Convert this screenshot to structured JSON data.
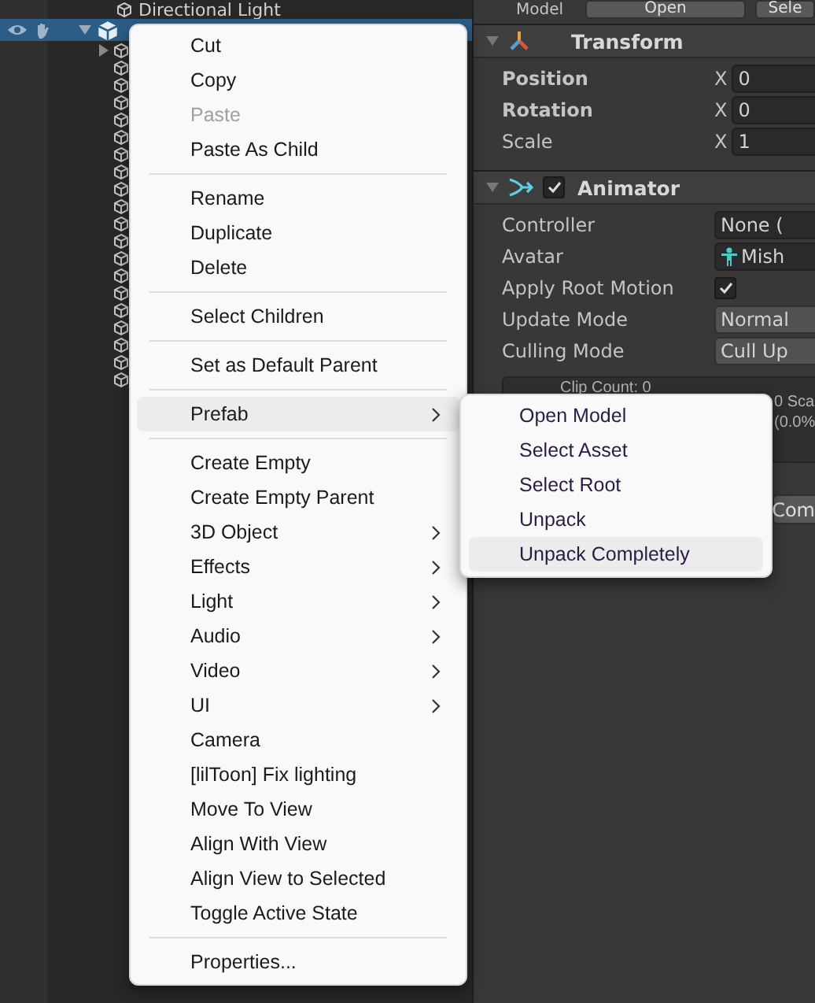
{
  "hierarchy": {
    "rows": [
      {
        "label": "Directional Light",
        "kind": "light",
        "selected": false
      },
      {
        "kind": "prefab",
        "selected": true
      }
    ],
    "children": [
      {
        "expandable": true
      },
      {
        "expandable": false
      },
      {
        "expandable": false
      },
      {
        "expandable": false
      },
      {
        "expandable": false
      },
      {
        "expandable": false
      },
      {
        "expandable": false
      },
      {
        "expandable": false
      },
      {
        "expandable": false
      },
      {
        "expandable": false
      },
      {
        "expandable": false
      },
      {
        "expandable": false
      },
      {
        "expandable": false
      },
      {
        "expandable": false
      },
      {
        "expandable": false
      },
      {
        "expandable": false
      },
      {
        "expandable": false
      },
      {
        "expandable": false
      },
      {
        "expandable": false
      },
      {
        "expandable": false
      }
    ]
  },
  "inspector": {
    "model_row": {
      "label": "Model",
      "buttons": [
        "Open",
        "Sele"
      ]
    },
    "transform": {
      "title": "Transform",
      "rows": [
        {
          "label": "Position",
          "modified": true,
          "axis": "X",
          "value": "0"
        },
        {
          "label": "Rotation",
          "modified": true,
          "axis": "X",
          "value": "0"
        },
        {
          "label": "Scale",
          "modified": false,
          "axis": "X",
          "value": "1"
        }
      ]
    },
    "animator": {
      "title": "Animator",
      "enabled": true,
      "rows": [
        {
          "label": "Controller",
          "kind": "object",
          "value": "None ("
        },
        {
          "label": "Avatar",
          "kind": "avatar",
          "value": "Mish"
        },
        {
          "label": "Apply Root Motion",
          "kind": "checkbox",
          "checked": true
        },
        {
          "label": "Update Mode",
          "kind": "dropdown",
          "value": "Normal"
        },
        {
          "label": "Culling Mode",
          "kind": "dropdown",
          "value": "Cull Up"
        }
      ],
      "info": {
        "clip_count": "Clip Count: 0",
        "right_lines": [
          "0 Sca",
          "(0.0%"
        ]
      },
      "button": "Com"
    }
  },
  "context_menu": {
    "groups": [
      [
        {
          "label": "Cut",
          "disabled": false,
          "has_submenu": false,
          "selected": false
        },
        {
          "label": "Copy",
          "disabled": false,
          "has_submenu": false,
          "selected": false
        },
        {
          "label": "Paste",
          "disabled": true,
          "has_submenu": false,
          "selected": false
        },
        {
          "label": "Paste As Child",
          "disabled": false,
          "has_submenu": false,
          "selected": false
        }
      ],
      [
        {
          "label": "Rename",
          "disabled": false,
          "has_submenu": false,
          "selected": false
        },
        {
          "label": "Duplicate",
          "disabled": false,
          "has_submenu": false,
          "selected": false
        },
        {
          "label": "Delete",
          "disabled": false,
          "has_submenu": false,
          "selected": false
        }
      ],
      [
        {
          "label": "Select Children",
          "disabled": false,
          "has_submenu": false,
          "selected": false
        }
      ],
      [
        {
          "label": "Set as Default Parent",
          "disabled": false,
          "has_submenu": false,
          "selected": false
        }
      ],
      [
        {
          "label": "Prefab",
          "disabled": false,
          "has_submenu": true,
          "selected": true
        }
      ],
      [
        {
          "label": "Create Empty",
          "disabled": false,
          "has_submenu": false,
          "selected": false
        },
        {
          "label": "Create Empty Parent",
          "disabled": false,
          "has_submenu": false,
          "selected": false
        },
        {
          "label": "3D Object",
          "disabled": false,
          "has_submenu": true,
          "selected": false
        },
        {
          "label": "Effects",
          "disabled": false,
          "has_submenu": true,
          "selected": false
        },
        {
          "label": "Light",
          "disabled": false,
          "has_submenu": true,
          "selected": false
        },
        {
          "label": "Audio",
          "disabled": false,
          "has_submenu": true,
          "selected": false
        },
        {
          "label": "Video",
          "disabled": false,
          "has_submenu": true,
          "selected": false
        },
        {
          "label": "UI",
          "disabled": false,
          "has_submenu": true,
          "selected": false
        },
        {
          "label": "Camera",
          "disabled": false,
          "has_submenu": false,
          "selected": false
        },
        {
          "label": "[lilToon] Fix lighting",
          "disabled": false,
          "has_submenu": false,
          "selected": false
        },
        {
          "label": "Move To View",
          "disabled": false,
          "has_submenu": false,
          "selected": false
        },
        {
          "label": "Align With View",
          "disabled": false,
          "has_submenu": false,
          "selected": false
        },
        {
          "label": "Align View to Selected",
          "disabled": false,
          "has_submenu": false,
          "selected": false
        },
        {
          "label": "Toggle Active State",
          "disabled": false,
          "has_submenu": false,
          "selected": false
        }
      ],
      [
        {
          "label": "Properties...",
          "disabled": false,
          "has_submenu": false,
          "selected": false
        }
      ]
    ]
  },
  "submenu": {
    "items": [
      {
        "label": "Open Model",
        "selected": false
      },
      {
        "label": "Select Asset",
        "selected": false
      },
      {
        "label": "Select Root",
        "selected": false
      },
      {
        "label": "Unpack",
        "selected": false
      },
      {
        "label": "Unpack Completely",
        "selected": true
      }
    ]
  }
}
